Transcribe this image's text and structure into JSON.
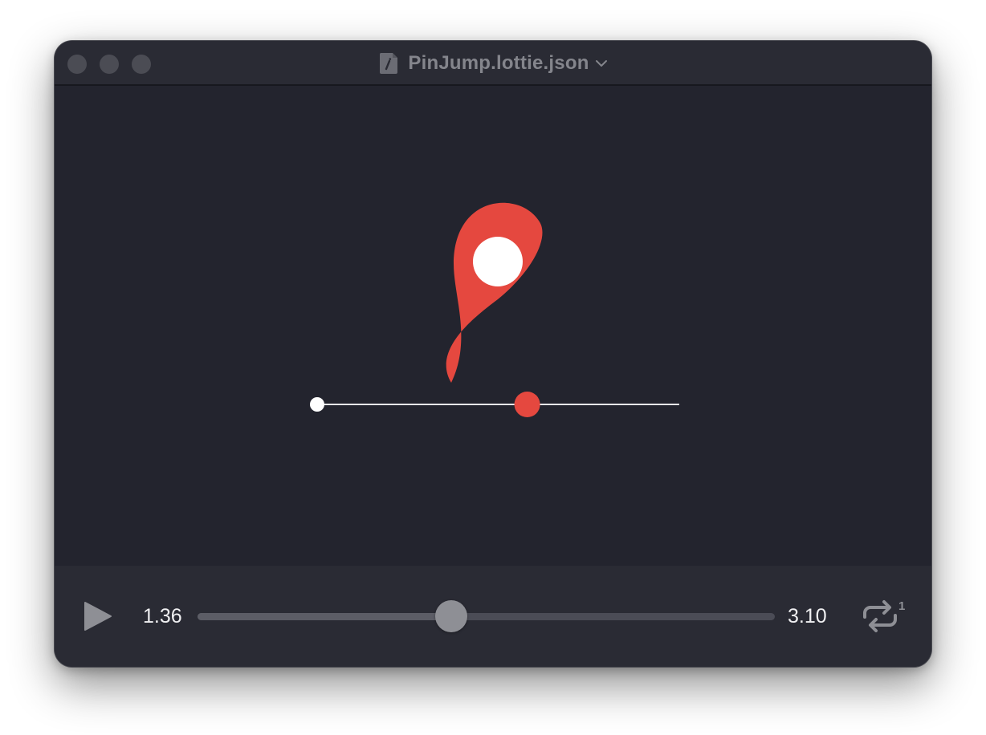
{
  "window": {
    "title": "PinJump.lottie.json"
  },
  "animation": {
    "pin_color": "#e5483f",
    "pin_center_color": "#ffffff",
    "line_color": "#e8e8ea",
    "start_dot_color": "#ffffff",
    "progress_dot_color": "#e5483f",
    "line_progress": 0.58
  },
  "player": {
    "current_time": "1.36",
    "total_time": "3.10",
    "progress": 0.44,
    "loop_badge": "1"
  },
  "icons": {
    "play": "play-icon",
    "loop": "repeat-once-icon",
    "document": "document-icon",
    "chevron": "chevron-down-icon"
  }
}
